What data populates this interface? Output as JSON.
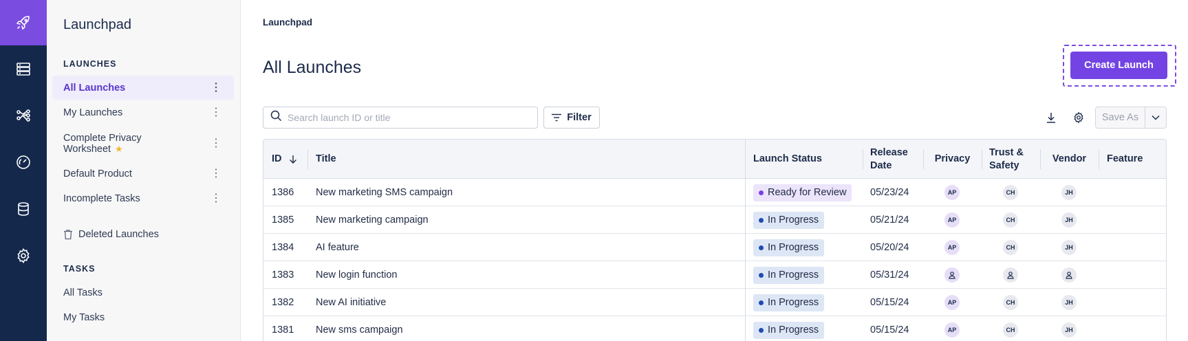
{
  "sidebar": {
    "title": "Launchpad",
    "launches_heading": "LAUNCHES",
    "items": [
      {
        "label": "All Launches"
      },
      {
        "label": "My Launches"
      },
      {
        "label": "Complete Privacy Worksheet"
      },
      {
        "label": "Default Product"
      },
      {
        "label": "Incomplete Tasks"
      }
    ],
    "deleted_label": "Deleted Launches",
    "tasks_heading": "TASKS",
    "tasks": [
      {
        "label": "All Tasks"
      },
      {
        "label": "My Tasks"
      }
    ]
  },
  "header": {
    "breadcrumb": "Launchpad",
    "title": "All Launches",
    "create_label": "Create Launch"
  },
  "toolbar": {
    "search_placeholder": "Search launch ID or title",
    "filter_label": "Filter",
    "save_as_label": "Save As"
  },
  "table": {
    "columns": [
      "ID",
      "Title",
      "Launch Status",
      "Release Date",
      "Privacy",
      "Trust & Safety",
      "Vendor",
      "Feature"
    ],
    "rows": [
      {
        "id": "1386",
        "title": "New marketing SMS campaign",
        "status": "Ready for Review",
        "date": "05/23/24",
        "privacy": "AP",
        "trust": "CH",
        "vendor": "JH"
      },
      {
        "id": "1385",
        "title": "New marketing campaign",
        "status": "In Progress",
        "date": "05/21/24",
        "privacy": "AP",
        "trust": "CH",
        "vendor": "JH"
      },
      {
        "id": "1384",
        "title": "AI feature",
        "status": "In Progress",
        "date": "05/20/24",
        "privacy": "AP",
        "trust": "CH",
        "vendor": "JH"
      },
      {
        "id": "1383",
        "title": "New login function",
        "status": "In Progress",
        "date": "05/31/24",
        "privacy": "",
        "trust": "",
        "vendor": ""
      },
      {
        "id": "1382",
        "title": "New AI initiative",
        "status": "In Progress",
        "date": "05/15/24",
        "privacy": "AP",
        "trust": "CH",
        "vendor": "JH"
      },
      {
        "id": "1381",
        "title": "New sms campaign",
        "status": "In Progress",
        "date": "05/15/24",
        "privacy": "AP",
        "trust": "CH",
        "vendor": "JH"
      }
    ]
  },
  "colors": {
    "rail": "#14284b",
    "accent": "#7344e3",
    "active_bg": "#efedfb"
  }
}
